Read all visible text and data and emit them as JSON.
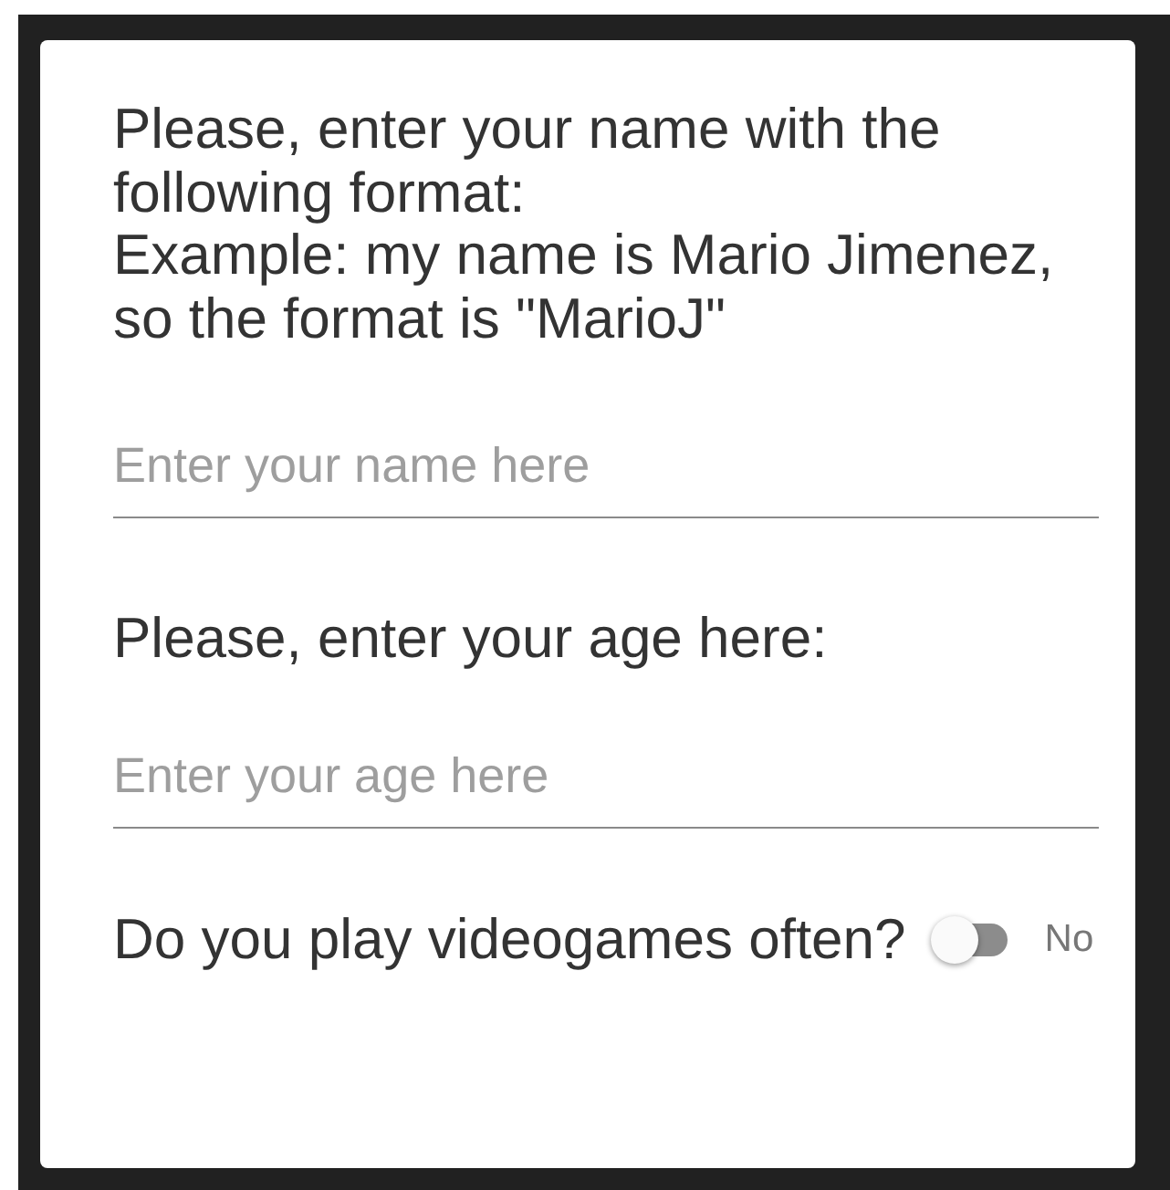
{
  "form": {
    "instructions": [
      "Please, enter your name with the following format:",
      "Example: my name is Mario Jimenez, so the format is \"MarioJ\""
    ],
    "name_field": {
      "placeholder": "Enter your name here"
    },
    "age_label": "Please, enter your age here:",
    "age_field": {
      "placeholder": "Enter your age here"
    },
    "videogames": {
      "label": "Do you play videogames often?",
      "on": false,
      "value": "No"
    }
  }
}
